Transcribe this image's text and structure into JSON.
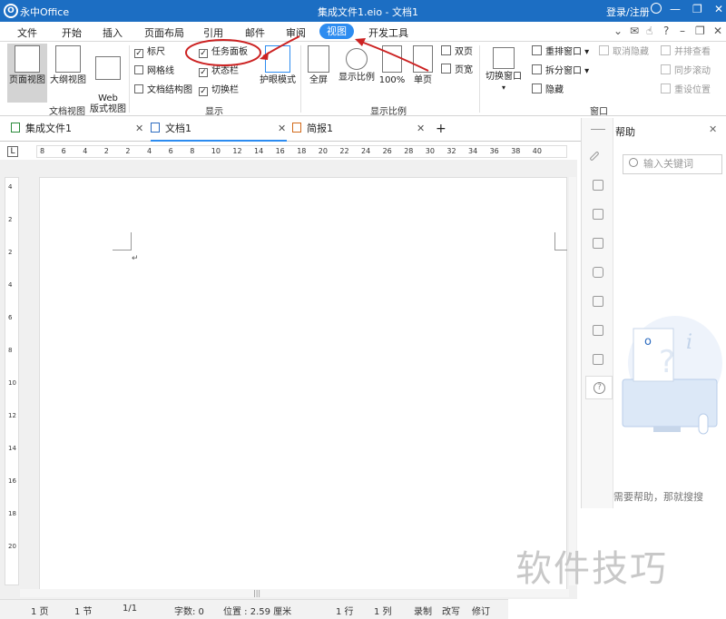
{
  "title_bar": {
    "app_name": "永中Office",
    "document_title": "集成文件1.eio - 文档1",
    "login": "登录/注册"
  },
  "menu": {
    "items": [
      "文件",
      "开始",
      "插入",
      "页面布局",
      "引用",
      "邮件",
      "审阅",
      "视图",
      "开发工具"
    ],
    "active": "视图"
  },
  "ribbon": {
    "doc_view": {
      "buttons": [
        "页面视图",
        "大纲视图",
        "Web\n版式视图"
      ],
      "label": "文档视图"
    },
    "display": {
      "checkboxes": [
        {
          "label": "标尺",
          "checked": true
        },
        {
          "label": "网格线",
          "checked": false
        },
        {
          "label": "文档结构图",
          "checked": false
        },
        {
          "label": "任务面板",
          "checked": true
        },
        {
          "label": "状态栏",
          "checked": true
        },
        {
          "label": "切换栏",
          "checked": true
        }
      ],
      "eye_mode": "护眼模式",
      "label": "显示"
    },
    "zoom": {
      "fullscreen": "全屏",
      "zoom_ratio": "显示比例",
      "hundred": "100%",
      "single_page": "单页",
      "double_page": "双页",
      "page_width": "页宽",
      "label": "显示比例"
    },
    "window": {
      "switch_window": "切换窗口",
      "arrange": "重排窗口",
      "split": "拆分窗口",
      "hide": "隐藏",
      "unhide": "取消隐藏",
      "side_by_side": "并排查看",
      "sync_scroll": "同步滚动",
      "reset_pos": "重设位置",
      "label": "窗口"
    }
  },
  "doc_tabs": [
    {
      "name": "集成文件1",
      "active": false
    },
    {
      "name": "文档1",
      "active": true
    },
    {
      "name": "简报1",
      "active": false
    }
  ],
  "ruler_ticks": [
    "8",
    "6",
    "4",
    "2",
    "2",
    "4",
    "6",
    "8",
    "10",
    "12",
    "14",
    "16",
    "18",
    "20",
    "22",
    "24",
    "26",
    "28",
    "30",
    "32",
    "34",
    "36",
    "38",
    "40"
  ],
  "vruler_ticks": [
    "4",
    "2",
    "2",
    "4",
    "6",
    "8",
    "10",
    "12",
    "14",
    "16",
    "18",
    "20"
  ],
  "help_panel": {
    "title": "帮助",
    "search_placeholder": "输入关键词",
    "text": "需要帮助，那就搜搜"
  },
  "status_bar": {
    "page": "1 页",
    "section": "1 节",
    "page_of": "1/1",
    "words": "字数: 0",
    "position": "位置 : 2.59 厘米",
    "line": "1 行",
    "col": "1 列",
    "record": "录制",
    "overwrite": "改写",
    "revise": "修订"
  },
  "watermark": "软件技巧",
  "colors": {
    "title_bar": "#1c6ec3",
    "active_menu": "#2d8cf0",
    "annotation": "#cc2222"
  }
}
